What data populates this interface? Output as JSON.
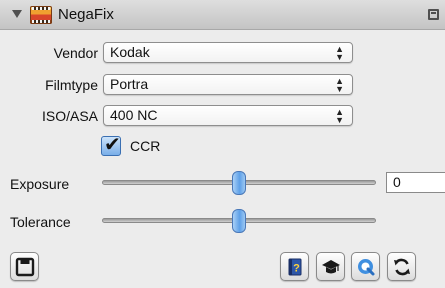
{
  "panel": {
    "title": "NegaFix"
  },
  "fields": {
    "vendor": {
      "label": "Vendor",
      "value": "Kodak"
    },
    "filmtype": {
      "label": "Filmtype",
      "value": "Portra"
    },
    "iso": {
      "label": "ISO/ASA",
      "value": "400 NC"
    }
  },
  "ccr": {
    "label": "CCR",
    "checked": true
  },
  "sliders": {
    "exposure": {
      "label": "Exposure",
      "value": "0",
      "level": 0.5
    },
    "tolerance": {
      "label": "Tolerance",
      "level": 0.5
    }
  },
  "toolbar": {
    "left": [
      "save-icon"
    ],
    "right": [
      "help-icon",
      "education-icon",
      "preview-icon",
      "reset-icon"
    ]
  },
  "colors": {
    "accent": "#5ea0e8",
    "background": "#ececec"
  }
}
